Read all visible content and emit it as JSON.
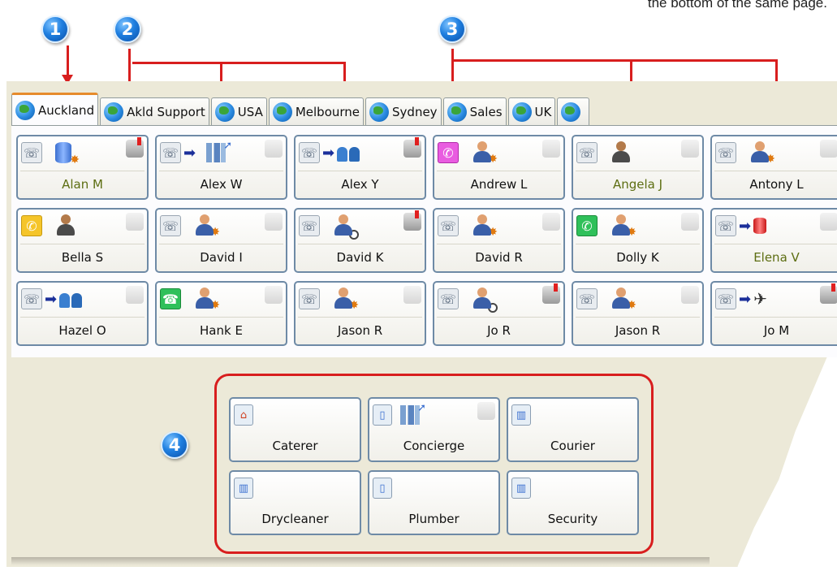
{
  "header_note": "the bottom of the same page.",
  "callouts": [
    "1",
    "2",
    "3",
    "4"
  ],
  "tabs": [
    {
      "label": "Auckland",
      "active": true
    },
    {
      "label": "Akld Support",
      "active": false
    },
    {
      "label": "USA",
      "active": false
    },
    {
      "label": "Melbourne",
      "active": false
    },
    {
      "label": "Sydney",
      "active": false
    },
    {
      "label": "Sales",
      "active": false
    },
    {
      "label": "UK",
      "active": false
    }
  ],
  "extensions": [
    {
      "name": "Alan M",
      "highlight": true
    },
    {
      "name": "Alex W",
      "highlight": false
    },
    {
      "name": "Alex Y",
      "highlight": false
    },
    {
      "name": "Andrew L",
      "highlight": false
    },
    {
      "name": "Angela J",
      "highlight": true
    },
    {
      "name": "Antony L",
      "highlight": false
    },
    {
      "name": "Bella S",
      "highlight": false
    },
    {
      "name": "David I",
      "highlight": false
    },
    {
      "name": "David K",
      "highlight": false
    },
    {
      "name": "David R",
      "highlight": false
    },
    {
      "name": "Dolly K",
      "highlight": false
    },
    {
      "name": "Elena V",
      "highlight": true
    },
    {
      "name": "Hazel O",
      "highlight": false
    },
    {
      "name": "Hank E",
      "highlight": false
    },
    {
      "name": "Jason R",
      "highlight": false
    },
    {
      "name": "Jo R",
      "highlight": false
    },
    {
      "name": "Jason R",
      "highlight": false
    },
    {
      "name": "Jo M",
      "highlight": false
    }
  ],
  "departments": [
    {
      "name": "Caterer"
    },
    {
      "name": "Concierge"
    },
    {
      "name": "Courier"
    },
    {
      "name": "Drycleaner"
    },
    {
      "name": "Plumber"
    },
    {
      "name": "Security"
    }
  ],
  "colors": {
    "accent_red": "#d81e1e",
    "tab_active": "#e68b2c",
    "callout_blue": "#1f7fe0",
    "highlight_name": "#5d6e12"
  }
}
